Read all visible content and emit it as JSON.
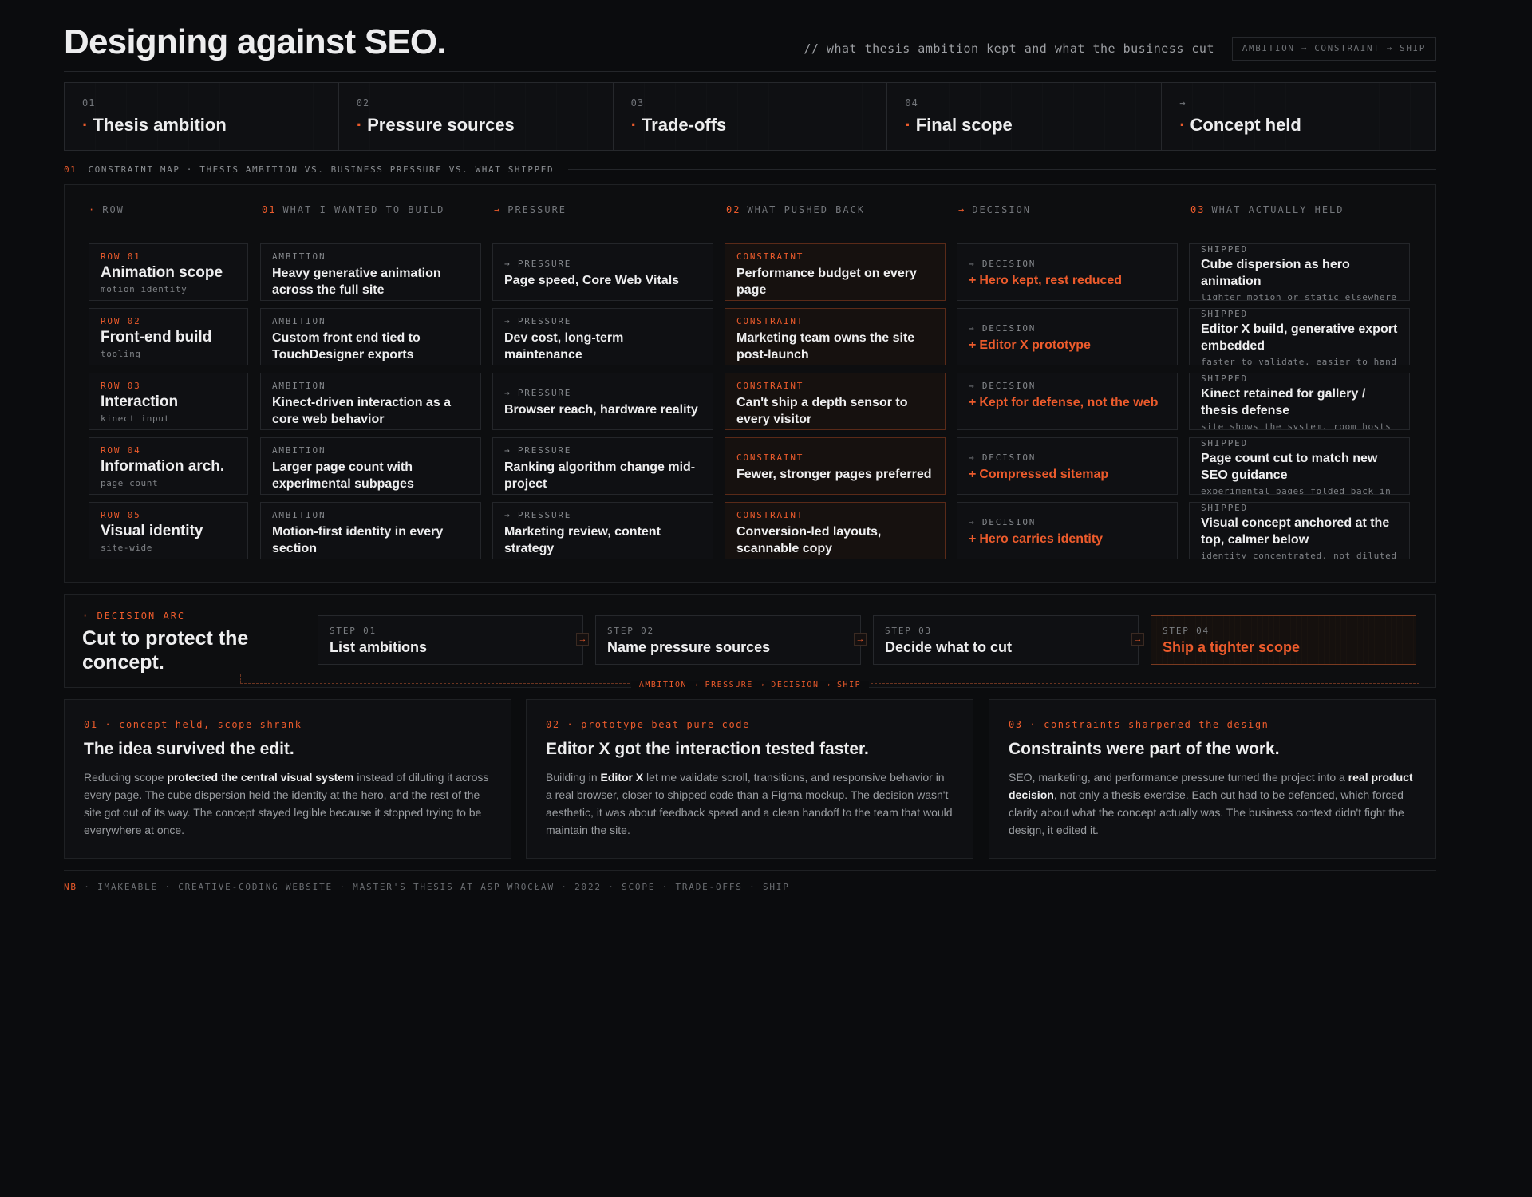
{
  "header": {
    "title": "Designing against SEO.",
    "tagline": "// what thesis ambition kept and what the business cut",
    "pipeline": "AMBITION → CONSTRAINT → SHIP"
  },
  "tabs": [
    {
      "num": "01",
      "label": "Thesis ambition"
    },
    {
      "num": "02",
      "label": "Pressure sources"
    },
    {
      "num": "03",
      "label": "Trade-offs"
    },
    {
      "num": "04",
      "label": "Final scope"
    },
    {
      "num": "→",
      "label": "Concept held"
    }
  ],
  "section": {
    "num": "01",
    "label": "CONSTRAINT MAP · THESIS AMBITION VS. BUSINESS PRESSURE VS. WHAT SHIPPED"
  },
  "columns": [
    {
      "mark": "·",
      "label": "ROW"
    },
    {
      "mark": "01",
      "label": "WHAT I WANTED TO BUILD"
    },
    {
      "mark": "→",
      "label": "PRESSURE"
    },
    {
      "mark": "02",
      "label": "WHAT PUSHED BACK"
    },
    {
      "mark": "→",
      "label": "DECISION"
    },
    {
      "mark": "03",
      "label": "WHAT ACTUALLY HELD"
    }
  ],
  "rows": [
    {
      "row": {
        "tag": "ROW 01",
        "title": "Animation scope",
        "sub": "motion identity"
      },
      "ambition": {
        "tag": "AMBITION",
        "text": "Heavy generative animation across the full site"
      },
      "pressure": {
        "tag": "→ PRESSURE",
        "text": "Page speed, Core Web Vitals"
      },
      "constraint": {
        "tag": "CONSTRAINT",
        "text": "Performance budget on every page"
      },
      "decision": {
        "tag": "→ DECISION",
        "text": "Hero kept, rest reduced"
      },
      "shipped": {
        "tag": "SHIPPED",
        "text": "Cube dispersion as hero animation",
        "sub": "lighter motion or static elsewhere"
      }
    },
    {
      "row": {
        "tag": "ROW 02",
        "title": "Front-end build",
        "sub": "tooling"
      },
      "ambition": {
        "tag": "AMBITION",
        "text": "Custom front end tied to TouchDesigner exports"
      },
      "pressure": {
        "tag": "→ PRESSURE",
        "text": "Dev cost, long-term maintenance"
      },
      "constraint": {
        "tag": "CONSTRAINT",
        "text": "Marketing team owns the site post-launch"
      },
      "decision": {
        "tag": "→ DECISION",
        "text": "Editor X prototype"
      },
      "shipped": {
        "tag": "SHIPPED",
        "text": "Editor X build, generative export embedded",
        "sub": "faster to validate, easier to hand off"
      }
    },
    {
      "row": {
        "tag": "ROW 03",
        "title": "Interaction",
        "sub": "kinect input"
      },
      "ambition": {
        "tag": "AMBITION",
        "text": "Kinect-driven interaction as a core web behavior"
      },
      "pressure": {
        "tag": "→ PRESSURE",
        "text": "Browser reach, hardware reality"
      },
      "constraint": {
        "tag": "CONSTRAINT",
        "text": "Can't ship a depth sensor to every visitor"
      },
      "decision": {
        "tag": "→ DECISION",
        "text": "Kept for defense, not the web"
      },
      "shipped": {
        "tag": "SHIPPED",
        "text": "Kinect retained for gallery / thesis defense",
        "sub": "site shows the system, room hosts the input"
      }
    },
    {
      "row": {
        "tag": "ROW 04",
        "title": "Information arch.",
        "sub": "page count"
      },
      "ambition": {
        "tag": "AMBITION",
        "text": "Larger page count with experimental subpages"
      },
      "pressure": {
        "tag": "→ PRESSURE",
        "text": "Ranking algorithm change mid-project"
      },
      "constraint": {
        "tag": "CONSTRAINT",
        "text": "Fewer, stronger pages preferred"
      },
      "decision": {
        "tag": "→ DECISION",
        "text": "Compressed sitemap"
      },
      "shipped": {
        "tag": "SHIPPED",
        "text": "Page count cut to match new SEO guidance",
        "sub": "experimental pages folded back in"
      }
    },
    {
      "row": {
        "tag": "ROW 05",
        "title": "Visual identity",
        "sub": "site-wide"
      },
      "ambition": {
        "tag": "AMBITION",
        "text": "Motion-first identity in every section"
      },
      "pressure": {
        "tag": "→ PRESSURE",
        "text": "Marketing review, content strategy"
      },
      "constraint": {
        "tag": "CONSTRAINT",
        "text": "Conversion-led layouts, scannable copy"
      },
      "decision": {
        "tag": "→ DECISION",
        "text": "Hero carries identity"
      },
      "shipped": {
        "tag": "SHIPPED",
        "text": "Visual concept anchored at the top, calmer below",
        "sub": "identity concentrated, not diluted"
      }
    }
  ],
  "arc": {
    "tag": "· DECISION ARC",
    "title": "Cut to protect the concept.",
    "steps": [
      {
        "k": "STEP 01",
        "v": "List ambitions"
      },
      {
        "k": "STEP 02",
        "v": "Name pressure sources"
      },
      {
        "k": "STEP 03",
        "v": "Decide what to cut"
      },
      {
        "k": "STEP 04",
        "v": "Ship a tighter scope"
      }
    ],
    "caption": "AMBITION → PRESSURE → DECISION → SHIP"
  },
  "cards": [
    {
      "k": "01 · concept held, scope shrank",
      "h": "The idea survived the edit.",
      "p1": "Reducing scope ",
      "b": "protected the central visual system",
      "p2": " instead of diluting it across every page. The cube dispersion held the identity at the hero, and the rest of the site got out of its way. The concept stayed legible because it stopped trying to be everywhere at once."
    },
    {
      "k": "02 · prototype beat pure code",
      "h": "Editor X got the interaction tested faster.",
      "p1": "Building in ",
      "b": "Editor X",
      "p2": " let me validate scroll, transitions, and responsive behavior in a real browser, closer to shipped code than a Figma mockup. The decision wasn't aesthetic, it was about feedback speed and a clean handoff to the team that would maintain the site."
    },
    {
      "k": "03 · constraints sharpened the design",
      "h": "Constraints were part of the work.",
      "p1": "SEO, marketing, and performance pressure turned the project into a ",
      "b": "real product decision",
      "p2": ", not only a thesis exercise. Each cut had to be defended, which forced clarity about what the concept actually was. The business context didn't fight the design, it edited it."
    }
  ],
  "footer": {
    "nb": "NB",
    "text": " · IMAKEABLE · CREATIVE-CODING WEBSITE · MASTER'S THESIS AT ASP WROCŁAW · 2022 · SCOPE · TRADE-OFFS · SHIP"
  }
}
